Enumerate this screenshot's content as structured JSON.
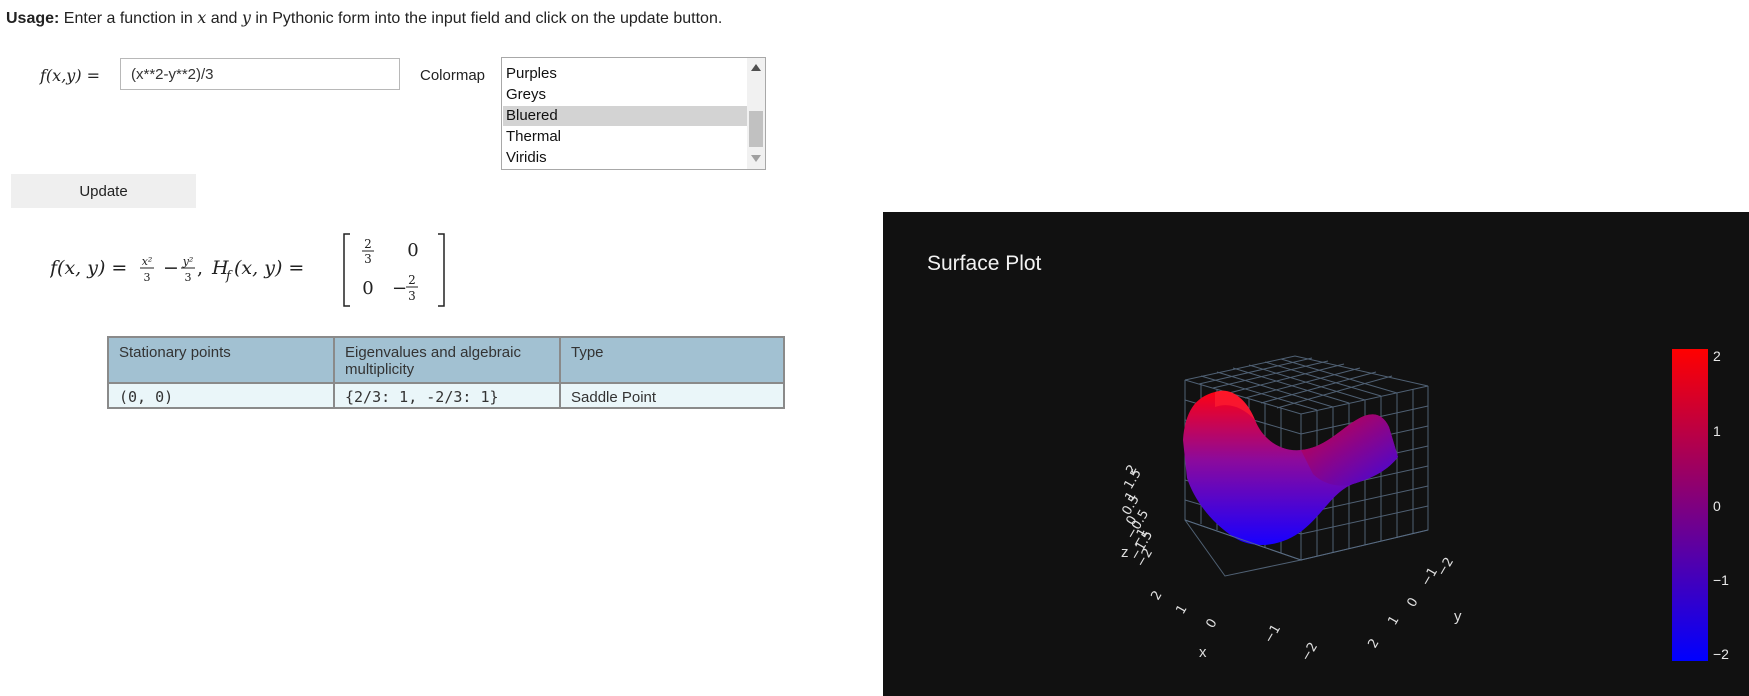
{
  "usage": {
    "bold": "Usage:",
    "text_1": " Enter a function in ",
    "var_x": "x",
    "text_2": " and ",
    "var_y": "y",
    "text_3": " in Pythonic form into the input field and click on the update button."
  },
  "form": {
    "function_label": "f(x,y) =",
    "function_value": "(x**2-y**2)/3",
    "colormap_label": "Colormap",
    "colormap_options": [
      "Purples",
      "Greys",
      "Bluered",
      "Thermal",
      "Viridis"
    ],
    "colormap_selected": "Bluered",
    "update_label": "Update"
  },
  "formula": {
    "lhs": "f(x, y) =",
    "x2": "x²",
    "y2": "y²",
    "den": "3",
    "minus": "−",
    "comma": ",",
    "hess": "H",
    "hess_sub": "f",
    "hess_args": "(x, y) =",
    "m11_num": "2",
    "m11_den": "3",
    "m12": "0",
    "m21": "0",
    "m22_sign": "−",
    "m22_num": "2",
    "m22_den": "3"
  },
  "table": {
    "headers": [
      "Stationary points",
      "Eigenvalues and algebraic multiplicity",
      "Type"
    ],
    "rows": [
      [
        "(0, 0)",
        "{2/3: 1, -2/3: 1}",
        "Saddle Point"
      ]
    ]
  },
  "plot": {
    "title": "Surface Plot",
    "x_label": "x",
    "y_label": "y",
    "z_label": "z",
    "z_ticks": [
      "2",
      "1.5",
      "1",
      "0.5",
      "0",
      "−0.5",
      "−1",
      "−1.5",
      "−2"
    ],
    "x_ticks": [
      "2",
      "1",
      "0",
      "−1",
      "−2"
    ],
    "y_ticks": [
      "−2",
      "−1",
      "0",
      "1",
      "2"
    ],
    "colorbar_ticks": [
      "2",
      "1",
      "0",
      "−1",
      "−2"
    ],
    "colors": {
      "high": "#ff0000",
      "mid": "#7f007f",
      "low": "#0000ff",
      "background": "#111111"
    }
  }
}
